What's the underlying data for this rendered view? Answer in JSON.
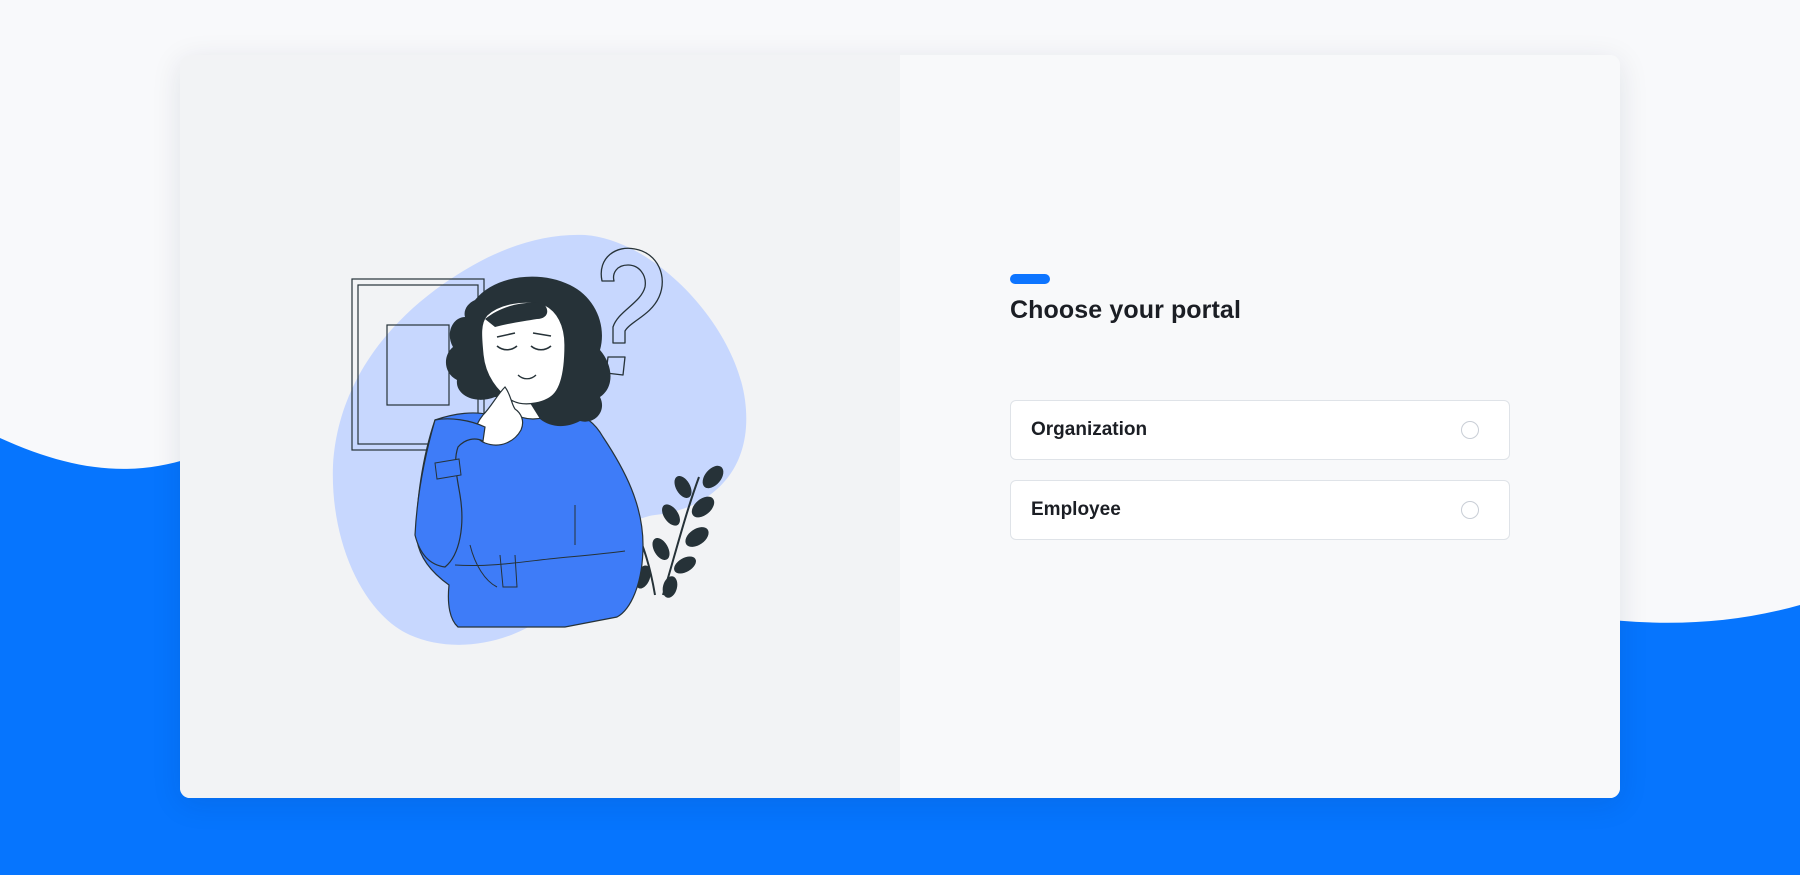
{
  "colors": {
    "accent": "#0d75ff",
    "background_wave": "#0675fe",
    "page_background": "#f8f9fb",
    "blob": "#c7d7fe",
    "sweater": "#3e7cf8",
    "ink": "#263238"
  },
  "portal": {
    "title": "Choose your portal",
    "options": [
      {
        "label": "Organization",
        "selected": false
      },
      {
        "label": "Employee",
        "selected": false
      }
    ]
  },
  "illustration": {
    "subject": "thinking-woman-illustration",
    "elements": [
      "question-mark-icon",
      "picture-frame-icon",
      "plant-icon"
    ]
  }
}
